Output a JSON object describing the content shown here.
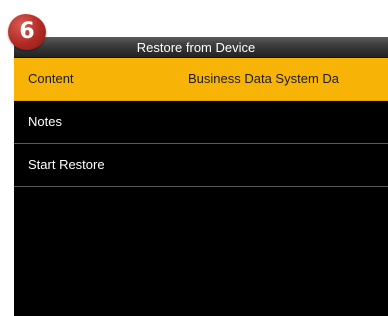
{
  "step_badge": "6",
  "titlebar": {
    "title": "Restore from Device"
  },
  "menu": {
    "items": [
      {
        "label": "Content",
        "value": "Business Data System Da",
        "selected": true
      },
      {
        "label": "Notes",
        "value": ""
      },
      {
        "label": "Start Restore",
        "value": ""
      }
    ]
  },
  "colors": {
    "selected_row": "#f8b307",
    "screen_background": "#000000",
    "badge": "#b02a24"
  }
}
